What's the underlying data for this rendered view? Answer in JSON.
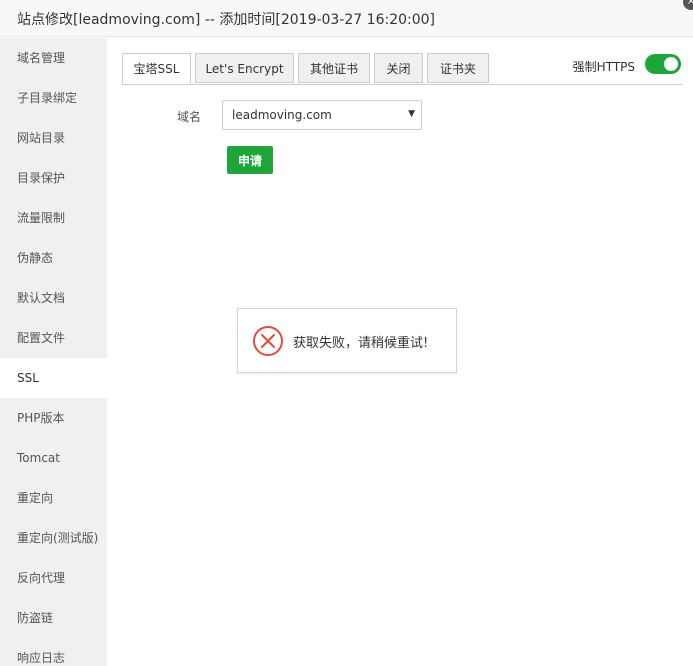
{
  "window": {
    "title": "站点修改[leadmoving.com] -- 添加时间[2019-03-27 16:20:00]",
    "close_glyph": "×"
  },
  "sidebar": {
    "items": [
      {
        "label": "域名管理",
        "active": false
      },
      {
        "label": "子目录绑定",
        "active": false
      },
      {
        "label": "网站目录",
        "active": false
      },
      {
        "label": "目录保护",
        "active": false
      },
      {
        "label": "流量限制",
        "active": false
      },
      {
        "label": "伪静态",
        "active": false
      },
      {
        "label": "默认文档",
        "active": false
      },
      {
        "label": "配置文件",
        "active": false
      },
      {
        "label": "SSL",
        "active": true
      },
      {
        "label": "PHP版本",
        "active": false
      },
      {
        "label": "Tomcat",
        "active": false
      },
      {
        "label": "重定向",
        "active": false
      },
      {
        "label": "重定向(测试版)",
        "active": false
      },
      {
        "label": "反向代理",
        "active": false
      },
      {
        "label": "防盗链",
        "active": false
      },
      {
        "label": "响应日志",
        "active": false
      }
    ]
  },
  "tabs": [
    {
      "label": "宝塔SSL",
      "active": true
    },
    {
      "label": "Let's Encrypt",
      "active": false
    },
    {
      "label": "其他证书",
      "active": false
    },
    {
      "label": "关闭",
      "active": false
    },
    {
      "label": "证书夹",
      "active": false
    }
  ],
  "https": {
    "label": "强制HTTPS",
    "enabled": true,
    "on_color": "#20a53a"
  },
  "form": {
    "domain_label": "域名",
    "domain_value": "leadmoving.com",
    "select_arrow": "▼",
    "apply_label": "申请"
  },
  "toast": {
    "icon": "error-circle-icon",
    "message": "获取失败，请稍候重试!",
    "icon_color": "#e24c3c"
  },
  "colors": {
    "accent": "#20a53a",
    "error": "#e24c3c"
  }
}
